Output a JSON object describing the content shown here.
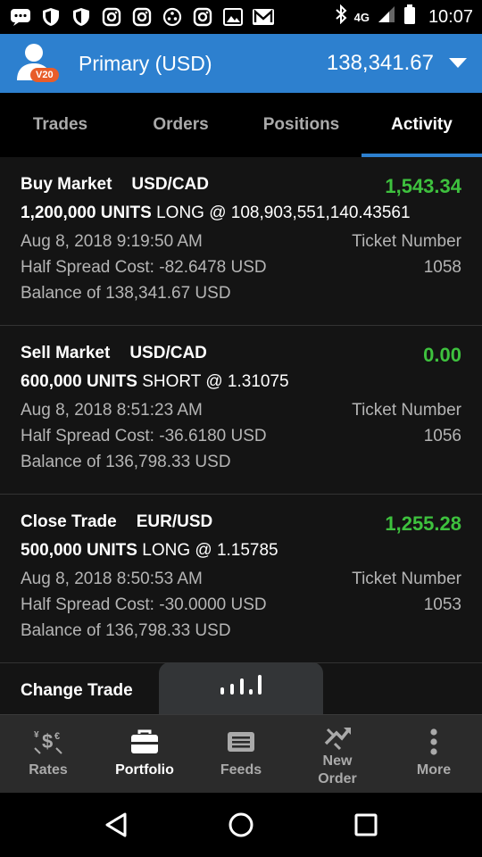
{
  "status_bar": {
    "time": "10:07",
    "network": "4G"
  },
  "account": {
    "badge": "V20",
    "name": "Primary (USD)",
    "balance": "138,341.67"
  },
  "tabs": [
    {
      "label": "Trades",
      "active": false
    },
    {
      "label": "Orders",
      "active": false
    },
    {
      "label": "Positions",
      "active": false
    },
    {
      "label": "Activity",
      "active": true
    }
  ],
  "activity": [
    {
      "type": "Buy Market",
      "pair": "USD/CAD",
      "amount": "1,543.34",
      "units": "1,200,000 UNITS",
      "detail": "LONG @ 108,903,551,140.43561",
      "date": "Aug 8, 2018 9:19:50 AM",
      "ticket_label": "Ticket Number",
      "ticket_number": "1058",
      "spread": "Half Spread Cost: -82.6478 USD",
      "balance": "Balance of 138,341.67 USD"
    },
    {
      "type": "Sell Market",
      "pair": "USD/CAD",
      "amount": "0.00",
      "units": "600,000 UNITS",
      "detail": "SHORT @ 1.31075",
      "date": "Aug 8, 2018 8:51:23 AM",
      "ticket_label": "Ticket Number",
      "ticket_number": "1056",
      "spread": "Half Spread Cost: -36.6180 USD",
      "balance": "Balance of 136,798.33 USD"
    },
    {
      "type": "Close Trade",
      "pair": "EUR/USD",
      "amount": "1,255.28",
      "units": "500,000 UNITS",
      "detail": "LONG @ 1.15785",
      "date": "Aug 8, 2018 8:50:53 AM",
      "ticket_label": "Ticket Number",
      "ticket_number": "1053",
      "spread": "Half Spread Cost: -30.0000 USD",
      "balance": "Balance of 136,798.33 USD"
    },
    {
      "type": "Change Trade"
    }
  ],
  "bottom_nav": [
    {
      "label": "Rates",
      "icon": "rates-icon",
      "active": false
    },
    {
      "label": "Portfolio",
      "icon": "briefcase-icon",
      "active": true
    },
    {
      "label": "Feeds",
      "icon": "feeds-icon",
      "active": false
    },
    {
      "label": "New\nOrder",
      "icon": "new-order-icon",
      "active": false
    },
    {
      "label": "More",
      "icon": "more-icon",
      "active": false
    }
  ],
  "colors": {
    "accent": "#2d80cf",
    "positive": "#3ec13e",
    "badge": "#e85d2a"
  }
}
